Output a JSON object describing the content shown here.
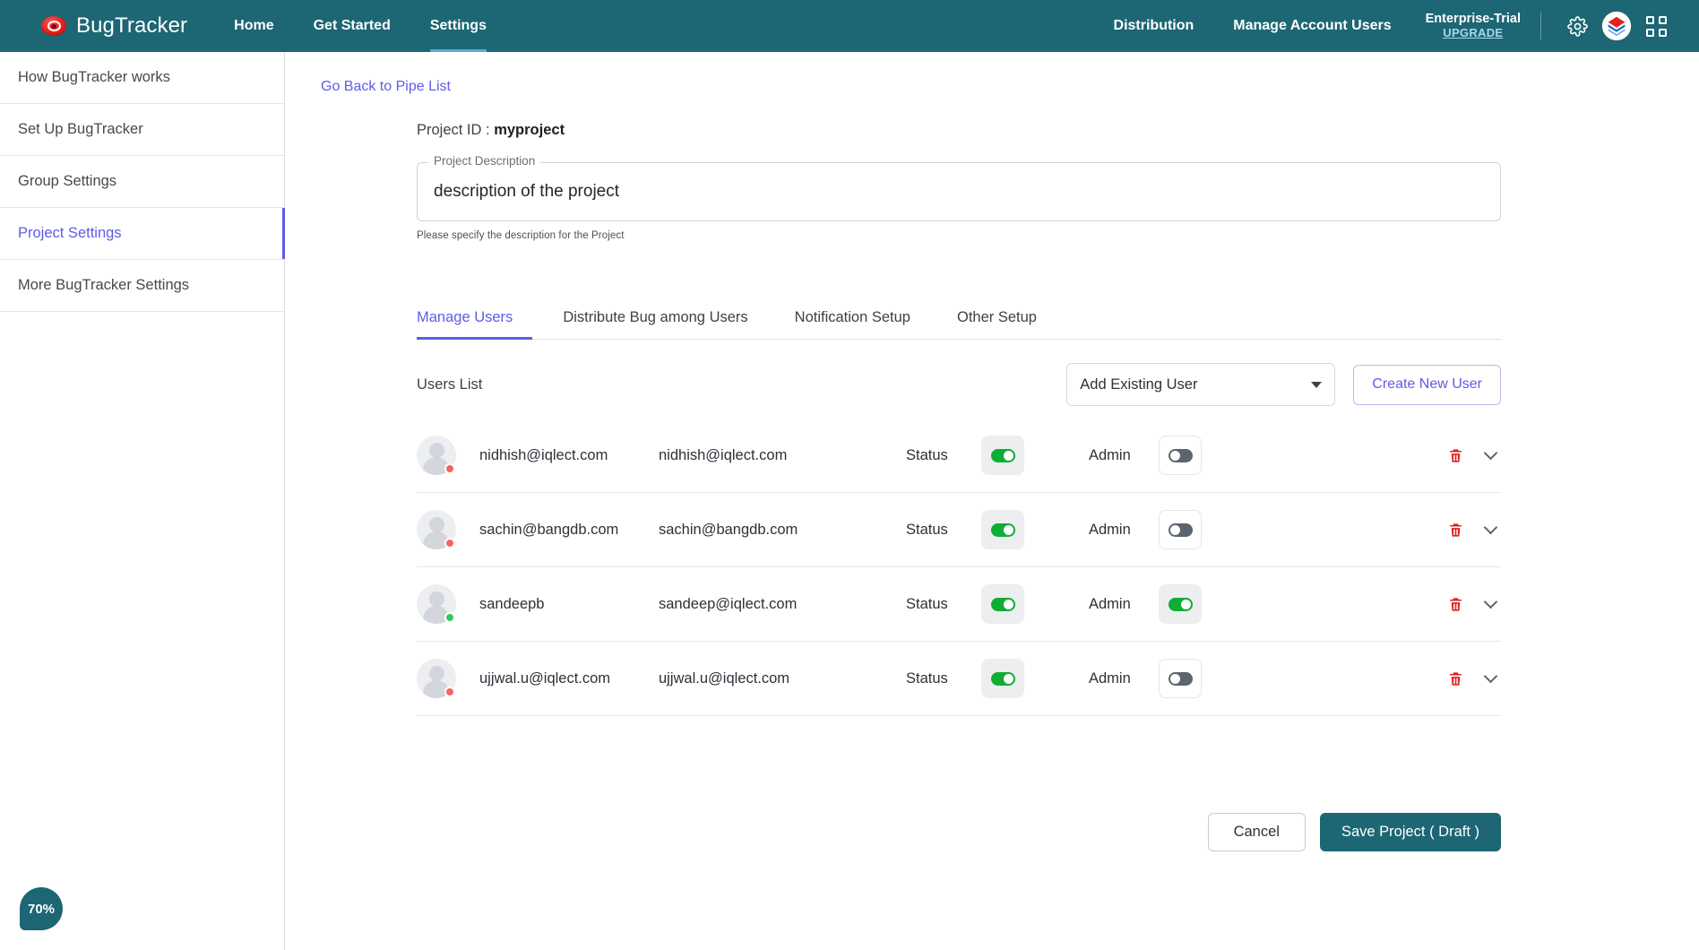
{
  "topnav": {
    "brand": "BugTracker",
    "brand_icon": "bug-eye-icon",
    "links": [
      {
        "label": "Home",
        "active": false
      },
      {
        "label": "Get Started",
        "active": false
      },
      {
        "label": "Settings",
        "active": true
      }
    ],
    "right_links": [
      {
        "label": "Distribution"
      },
      {
        "label": "Manage Account Users"
      }
    ],
    "plan": "Enterprise-Trial",
    "upgrade": "UPGRADE",
    "icons": [
      "gear-icon",
      "cube-logo-icon",
      "apps-grid-icon"
    ],
    "bg_color": "#1d6674",
    "active_underline_color": "#5aa9d6"
  },
  "sidebar": {
    "items": [
      {
        "label": "How BugTracker works",
        "active": false
      },
      {
        "label": "Set Up BugTracker",
        "active": false
      },
      {
        "label": "Group Settings",
        "active": false
      },
      {
        "label": "Project Settings",
        "active": true
      },
      {
        "label": "More BugTracker Settings",
        "active": false
      }
    ],
    "active_color": "#5f5ce6"
  },
  "main": {
    "back_link": "Go Back to Pipe List",
    "project_id_label": "Project ID :",
    "project_id_value": "myproject",
    "description_label": "Project Description",
    "description_value": "description of the project",
    "description_placeholder": "description of the project",
    "description_help": "Please specify the description for the Project",
    "tabs": [
      {
        "label": "Manage Users",
        "active": true
      },
      {
        "label": "Distribute Bug among Users",
        "active": false
      },
      {
        "label": "Notification Setup",
        "active": false
      },
      {
        "label": "Other Setup",
        "active": false
      }
    ],
    "users_list_title": "Users List",
    "add_existing_user_value": "Add Existing User",
    "create_new_user_label": "Create New User",
    "status_label": "Status",
    "admin_label": "Admin",
    "rows": [
      {
        "name": "nidhish@iqlect.com",
        "email": "nidhish@iqlect.com",
        "presence": "offline",
        "status_on": true,
        "admin_on": false
      },
      {
        "name": "sachin@bangdb.com",
        "email": "sachin@bangdb.com",
        "presence": "offline",
        "status_on": true,
        "admin_on": false
      },
      {
        "name": "sandeepb",
        "email": "sandeep@iqlect.com",
        "presence": "online",
        "status_on": true,
        "admin_on": true
      },
      {
        "name": "ujjwal.u@iqlect.com",
        "email": "ujjwal.u@iqlect.com",
        "presence": "offline",
        "status_on": true,
        "admin_on": false
      }
    ],
    "cancel_label": "Cancel",
    "save_label": "Save Project ( Draft )",
    "progress_badge": "70%",
    "delete_icon_color": "#e02020",
    "toggle_on_color": "#0ead35"
  }
}
